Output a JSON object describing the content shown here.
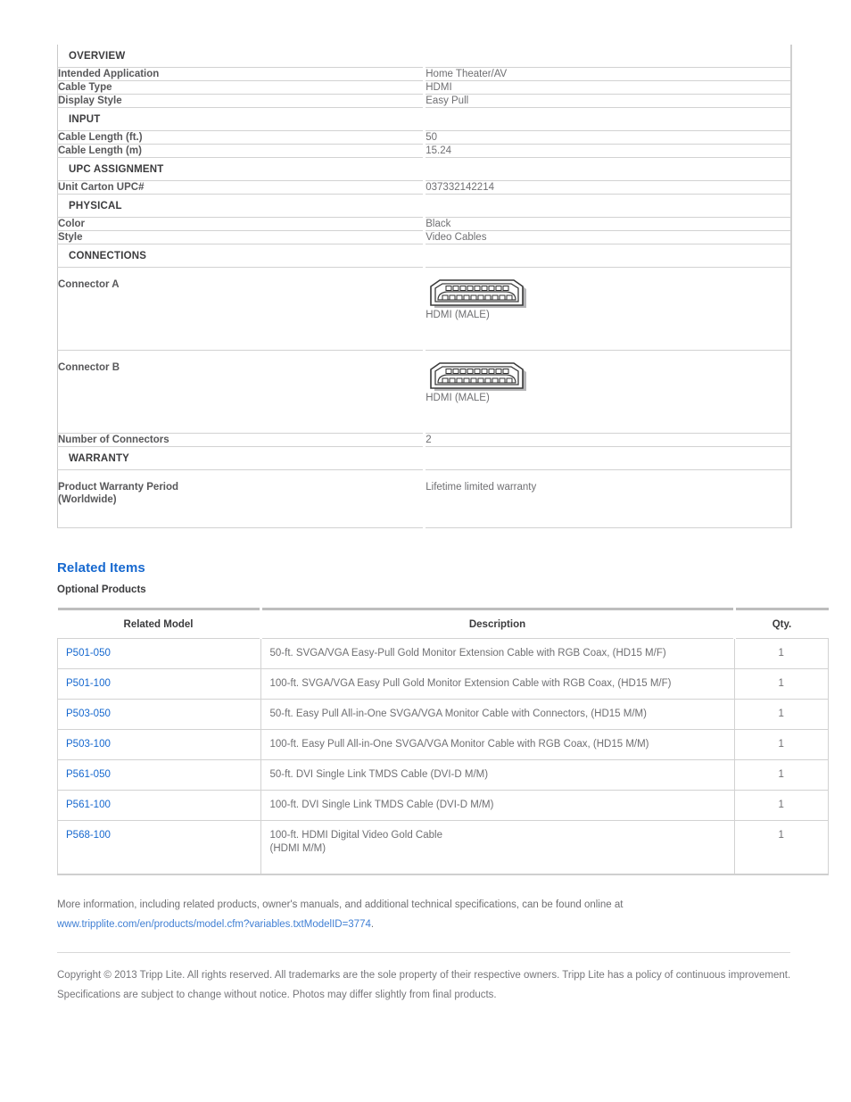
{
  "spec_table": {
    "rows": [
      {
        "kind": "section",
        "label": "OVERVIEW"
      },
      {
        "kind": "pair",
        "label": "Intended Application",
        "value": "Home Theater/AV"
      },
      {
        "kind": "pair",
        "label": "Cable Type",
        "value": "HDMI"
      },
      {
        "kind": "pair",
        "label": "Display Style",
        "value": "Easy Pull"
      },
      {
        "kind": "section",
        "label": "INPUT"
      },
      {
        "kind": "pair",
        "label": "Cable Length (ft.)",
        "value": "50"
      },
      {
        "kind": "pair",
        "label": "Cable Length (m)",
        "value": "15.24"
      },
      {
        "kind": "section",
        "label": "UPC ASSIGNMENT"
      },
      {
        "kind": "pair",
        "label": "Unit Carton UPC#",
        "value": "037332142214"
      },
      {
        "kind": "section",
        "label": "PHYSICAL"
      },
      {
        "kind": "pair",
        "label": "Color",
        "value": "Black"
      },
      {
        "kind": "pair",
        "label": "Style",
        "value": "Video Cables"
      },
      {
        "kind": "section",
        "label": "CONNECTIONS"
      },
      {
        "kind": "connector",
        "label": "Connector A",
        "value": "HDMI (MALE)"
      },
      {
        "kind": "connector",
        "label": "Connector B",
        "value": "HDMI (MALE)"
      },
      {
        "kind": "pair",
        "label": "Number of Connectors",
        "value": "2"
      },
      {
        "kind": "section",
        "label": "WARRANTY"
      },
      {
        "kind": "warranty",
        "label": "Product Warranty Period (Worldwide)",
        "value": "Lifetime limited warranty"
      }
    ],
    "connector_a": {
      "label": "Connector A",
      "caption": "HDMI (MALE)"
    },
    "connector_b": {
      "label": "Connector B",
      "caption": "HDMI (MALE)"
    },
    "warranty_row": {
      "label_line1": "Product Warranty Period",
      "label_line2": "(Worldwide)",
      "value": "Lifetime limited warranty"
    }
  },
  "related": {
    "heading": "Related Items",
    "subheading": "Optional Products",
    "columns": {
      "model": "Related Model",
      "description": "Description",
      "qty": "Qty."
    },
    "rows": [
      {
        "model": "P501-050",
        "description": "50-ft. SVGA/VGA Easy-Pull Gold Monitor Extension Cable with RGB Coax, (HD15 M/F)",
        "description2": "",
        "qty": "1"
      },
      {
        "model": "P501-100",
        "description": "100-ft. SVGA/VGA Easy Pull Gold Monitor Extension Cable with RGB Coax, (HD15 M/F)",
        "description2": "",
        "qty": "1"
      },
      {
        "model": "P503-050",
        "description": "50-ft. Easy Pull All-in-One SVGA/VGA Monitor Cable with Connectors, (HD15 M/M)",
        "description2": "",
        "qty": "1"
      },
      {
        "model": "P503-100",
        "description": "100-ft. Easy Pull All-in-One SVGA/VGA Monitor Cable with RGB Coax, (HD15 M/M)",
        "description2": "",
        "qty": "1"
      },
      {
        "model": "P561-050",
        "description": "50-ft. DVI Single Link TMDS Cable (DVI-D M/M)",
        "description2": "",
        "qty": "1"
      },
      {
        "model": "P561-100",
        "description": "100-ft. DVI Single Link TMDS Cable (DVI-D M/M)",
        "description2": "",
        "qty": "1"
      },
      {
        "model": "P568-100",
        "description": "100-ft. HDMI Digital Video Gold Cable",
        "description2": "(HDMI M/M)",
        "qty": "1"
      }
    ]
  },
  "footer": {
    "more_info_text": "More information, including related products, owner's manuals, and additional technical specifications, can be found online at",
    "url": "www.tripplite.com/en/products/model.cfm?variables.txtModelID=3774",
    "url_suffix": ".",
    "copyright": "Copyright © 2013 Tripp Lite. All rights reserved. All trademarks are the sole property of their respective owners. Tripp Lite has a policy of continuous improvement. Specifications are subject to change without notice. Photos may differ slightly from final products."
  },
  "colors": {
    "link_blue": "#1668cf",
    "heading_blue": "#1668cf",
    "body_gray": "#6f6f72",
    "label_gray": "#58585a",
    "border_gray": "#d2d2d2"
  }
}
